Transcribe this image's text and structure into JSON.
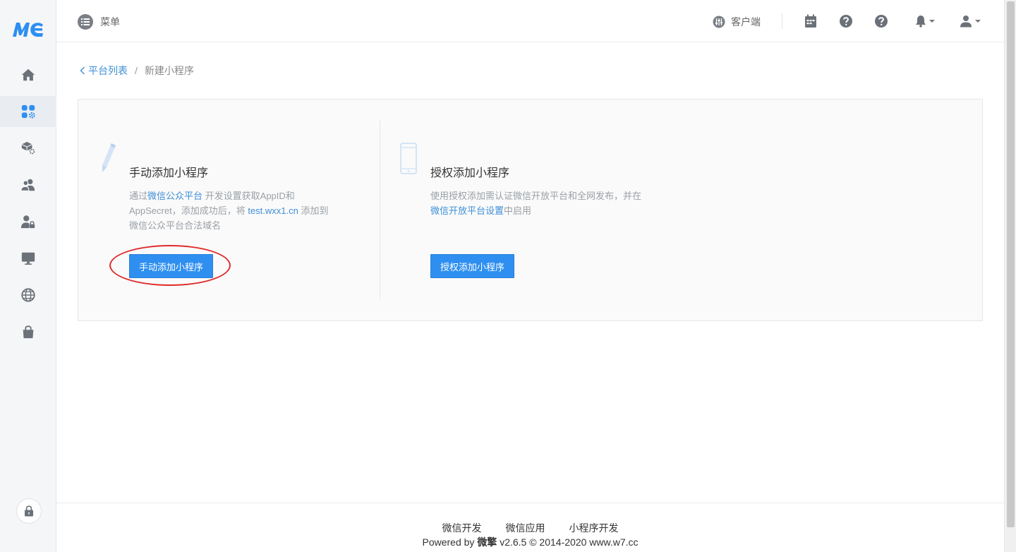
{
  "sidebar": {
    "logo_text": "MC",
    "items": [
      {
        "icon": "home-icon"
      },
      {
        "icon": "apps-settings-icon",
        "active": true
      },
      {
        "icon": "package-settings-icon"
      },
      {
        "icon": "users-icon"
      },
      {
        "icon": "user-lock-icon"
      },
      {
        "icon": "monitor-icon"
      },
      {
        "icon": "globe-icon"
      },
      {
        "icon": "shopping-bag-icon"
      }
    ],
    "lock_icon": "lock-icon"
  },
  "header": {
    "menu_label": "菜单",
    "client_label": "客户端"
  },
  "breadcrumb": {
    "back_label": "平台列表",
    "separator": "/",
    "current": "新建小程序"
  },
  "manual": {
    "title": "手动添加小程序",
    "desc_prefix": "通过",
    "desc_link1": "微信公众平台",
    "desc_mid1": " 开发设置获取AppID和",
    "desc_mid2": "AppSecret，添加成功后，将 ",
    "desc_link2": "test.wxx1.cn",
    "desc_mid3": " 添加到",
    "desc_suffix": "微信公众平台合法域名",
    "button_label": "手动添加小程序"
  },
  "auth": {
    "title": "授权添加小程序",
    "desc_line1": "使用授权添加需认证微信开放平台和全网发布，并在",
    "desc_link": "微信开放平台设置",
    "desc_suffix": "中启用",
    "button_label": "授权添加小程序"
  },
  "footer": {
    "links": [
      "微信开发",
      "微信应用",
      "小程序开发"
    ],
    "powered_prefix": "Powered by ",
    "powered_brand": "微擎",
    "powered_suffix": " v2.6.5 © 2014-2020 www.w7.cc"
  },
  "colors": {
    "primary": "#2e8ff0",
    "link": "#3d8fd6",
    "highlight": "#e02a2a"
  }
}
